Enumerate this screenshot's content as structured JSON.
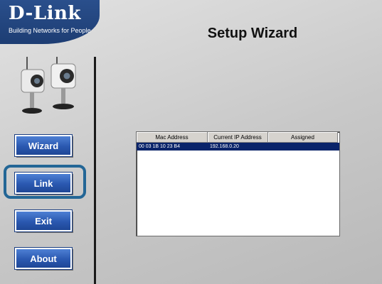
{
  "brand": {
    "logo": "D-Link",
    "tagline": "Building Networks for People"
  },
  "title": "Setup Wizard",
  "nav": [
    {
      "label": "Wizard",
      "icon": ""
    },
    {
      "label": "Link"
    },
    {
      "label": "Exit"
    },
    {
      "label": "About"
    }
  ],
  "device_list": {
    "columns": [
      "Mac Address",
      "Current IP Address",
      "Assigned"
    ],
    "rows": [
      {
        "mac": "00 03 1B 10 23 B4",
        "ip": "192.168.0.20",
        "assigned": ""
      }
    ]
  },
  "colors": {
    "brand_blue": "#1d3d73",
    "button_blue": "#2a58b0",
    "selection": "#0a246a",
    "focus_ring": "#236696"
  }
}
